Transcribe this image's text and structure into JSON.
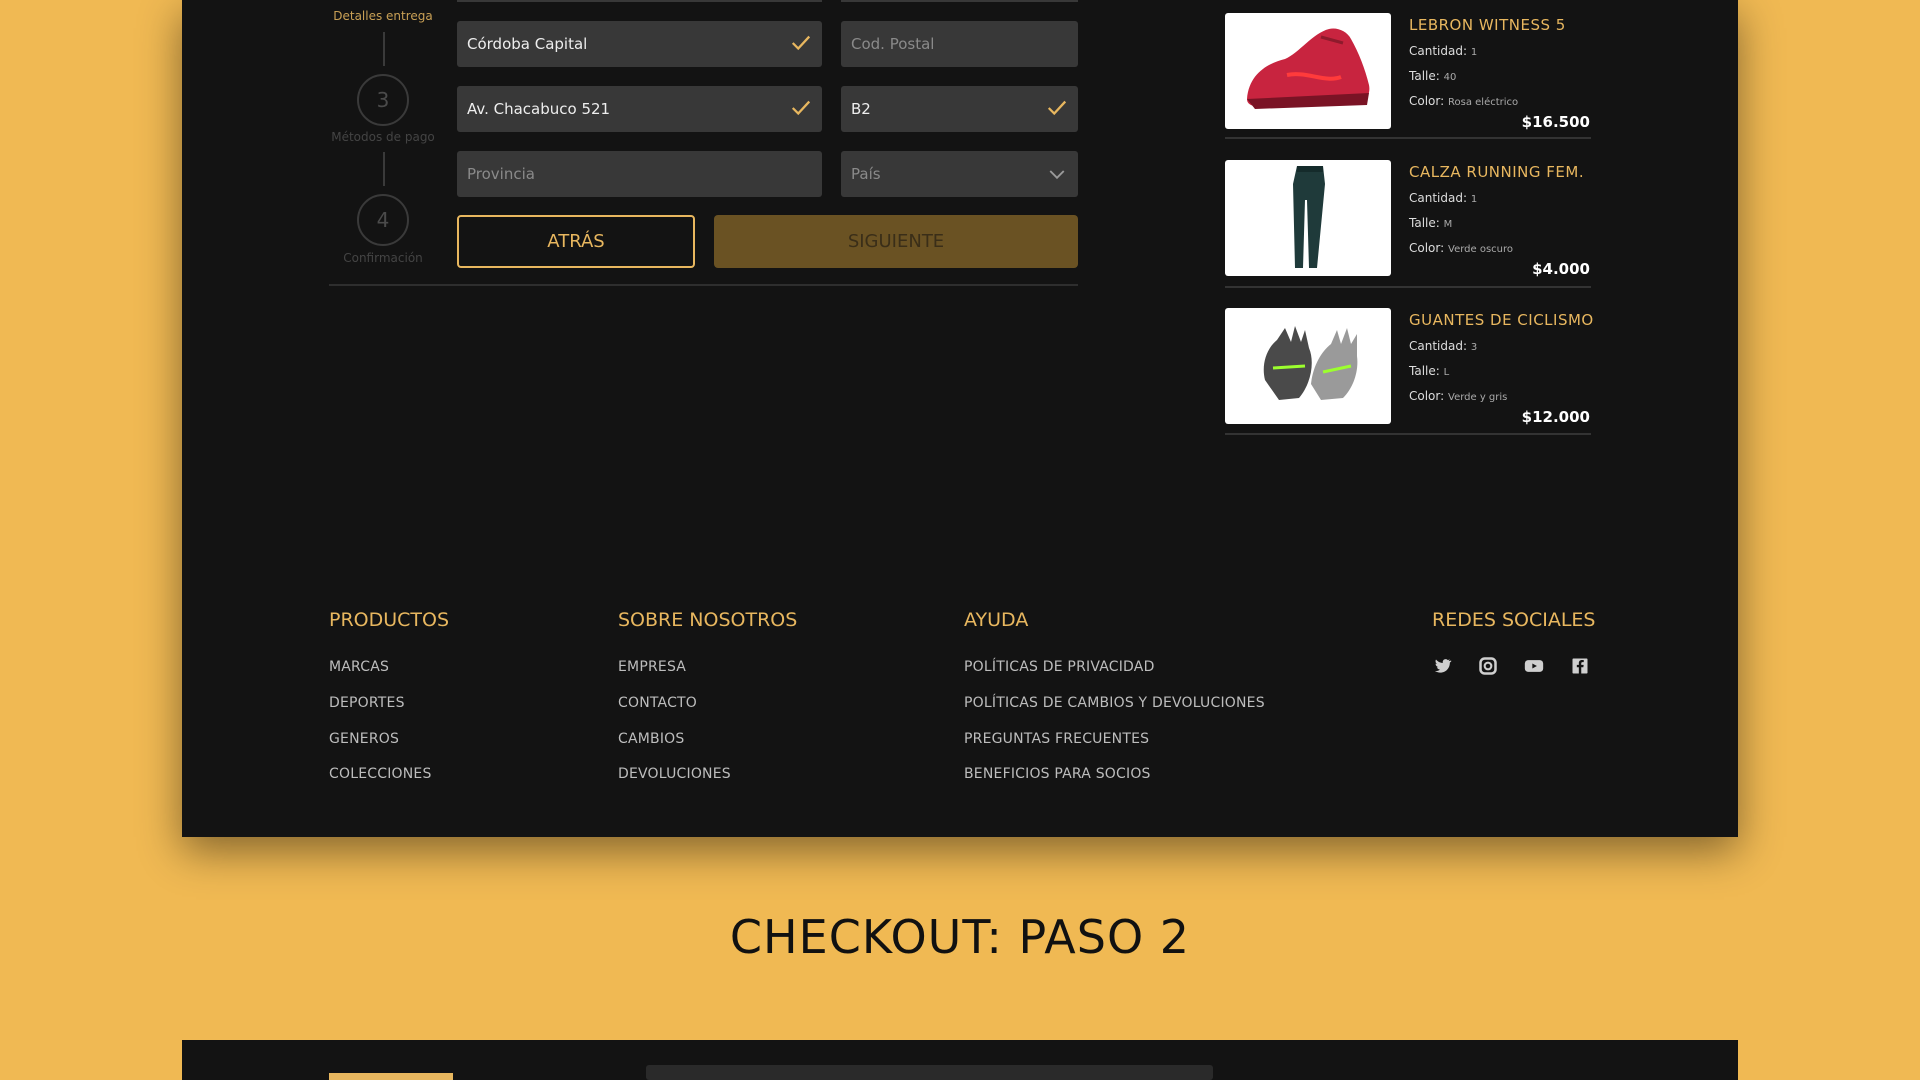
{
  "stepper": {
    "step2_label": "Detalles entrega",
    "step3_number": "3",
    "step3_label": "Métodos de pago",
    "step4_number": "4",
    "step4_label": "Confirmación"
  },
  "form": {
    "city": "Córdoba Capital",
    "postal_placeholder": "Cod. Postal",
    "address": "Av. Chacabuco 521",
    "apartment": "B2",
    "province_placeholder": "Provincia",
    "country_placeholder": "País",
    "back_label": "ATRÁS",
    "next_label": "SIGUIENTE"
  },
  "cart": {
    "items": [
      {
        "name": "LEBRON WITNESS 5",
        "qty_label": "Cantidad:",
        "qty": "1",
        "size_label": "Talle:",
        "size": "40",
        "color_label": "Color:",
        "color": "Rosa eléctrico",
        "price": "$16.500",
        "icon": "sneaker-image"
      },
      {
        "name": "CALZA RUNNING FEM.",
        "qty_label": "Cantidad:",
        "qty": "1",
        "size_label": "Talle:",
        "size": "M",
        "color_label": "Color:",
        "color": "Verde oscuro",
        "price": "$4.000",
        "icon": "leggings-image"
      },
      {
        "name": "GUANTES DE CICLISMO",
        "qty_label": "Cantidad:",
        "qty": "3",
        "size_label": "Talle:",
        "size": "L",
        "color_label": "Color:",
        "color": "Verde y gris",
        "price": "$12.000",
        "icon": "gloves-image"
      }
    ]
  },
  "footer": {
    "products": {
      "title": "PRODUCTOS",
      "links": [
        "MARCAS",
        "DEPORTES",
        "GENEROS",
        "COLECCIONES"
      ]
    },
    "about": {
      "title": "SOBRE NOSOTROS",
      "links": [
        "EMPRESA",
        "CONTACTO",
        "CAMBIOS",
        "DEVOLUCIONES"
      ]
    },
    "help": {
      "title": "AYUDA",
      "links": [
        "POLÍTICAS DE PRIVACIDAD",
        "POLÍTICAS DE CAMBIOS Y DEVOLUCIONES",
        "PREGUNTAS FRECUENTES",
        "BENEFICIOS PARA SOCIOS"
      ]
    },
    "social": {
      "title": "REDES SOCIALES",
      "icons": [
        "twitter-icon",
        "instagram-icon",
        "youtube-icon",
        "facebook-icon"
      ]
    }
  },
  "section_title": "CHECKOUT: PASO 2",
  "colors": {
    "accent": "#e8b75f",
    "background": "#f0b953",
    "panel": "#131313",
    "field": "#383838"
  }
}
